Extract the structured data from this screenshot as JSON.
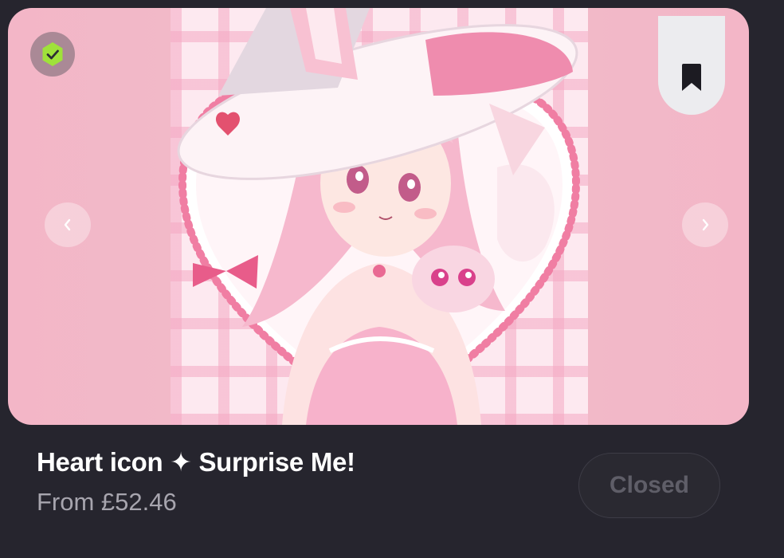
{
  "listing": {
    "title": "Heart icon ✦ Surprise Me!",
    "price": "From £52.46",
    "status_label": "Closed"
  },
  "icons": {
    "verified": "verified-check-icon",
    "bookmark": "bookmark-icon",
    "prev": "chevron-left-icon",
    "next": "chevron-right-icon"
  },
  "colors": {
    "background": "#26252e",
    "media_pink": "#f3b6c7",
    "verified_green": "#9fe23a",
    "title": "#ffffff",
    "price": "#a7a5ae",
    "closed_text": "#5f5e68"
  }
}
